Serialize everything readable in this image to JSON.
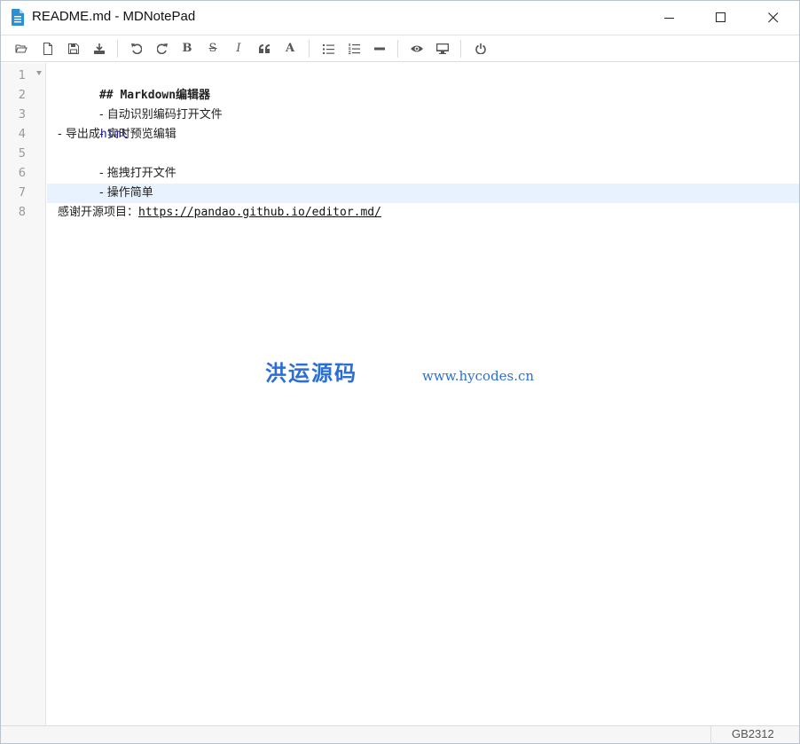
{
  "window": {
    "title": "README.md - MDNotePad"
  },
  "toolbar": [
    {
      "name": "open-file-button",
      "icon": "folder-open-icon"
    },
    {
      "name": "new-file-button",
      "icon": "file-icon"
    },
    {
      "name": "save-button",
      "icon": "save-icon"
    },
    {
      "name": "export-button",
      "icon": "download-icon"
    },
    {
      "name": "undo-button",
      "icon": "undo-icon"
    },
    {
      "name": "redo-button",
      "icon": "redo-icon"
    },
    {
      "name": "bold-button",
      "icon": "bold-icon",
      "text": "B"
    },
    {
      "name": "strikethrough-button",
      "icon": "strikethrough-icon",
      "text": "S"
    },
    {
      "name": "italic-button",
      "icon": "italic-icon",
      "text": "I"
    },
    {
      "name": "quote-button",
      "icon": "quote-icon"
    },
    {
      "name": "uppercase-button",
      "icon": "font-icon",
      "text": "A"
    },
    {
      "name": "bullet-list-button",
      "icon": "list-ul-icon"
    },
    {
      "name": "ordered-list-button",
      "icon": "list-ol-icon"
    },
    {
      "name": "horizontal-rule-button",
      "icon": "minus-icon"
    },
    {
      "name": "preview-button",
      "icon": "eye-icon"
    },
    {
      "name": "fullscreen-preview-button",
      "icon": "desktop-icon"
    },
    {
      "name": "exit-button",
      "icon": "power-icon"
    }
  ],
  "editor": {
    "line_numbers": [
      "1",
      "2",
      "3",
      "4",
      "5",
      "6",
      "7",
      "8"
    ],
    "lines": {
      "l1": "## Markdown编辑器",
      "l2": "- 自动识别编码打开文件",
      "l3": "- 实时预览编辑",
      "l4_prefix": "- 导出成",
      "l4_code": "html",
      "l5": "- 拖拽打开文件",
      "l6": "- 操作简单",
      "l7": "",
      "l8_prefix": "感谢开源项目：",
      "l8_link": "https://pandao.github.io/editor.md/"
    },
    "current_line": 7
  },
  "watermark": {
    "text_cn": "洪运源码",
    "url": "www.hycodes.cn"
  },
  "statusbar": {
    "encoding": "GB2312"
  },
  "colors": {
    "accent": "#2a6fd6",
    "current_line_bg": "#e8f2ff",
    "gutter_bg": "#f7f7f7"
  }
}
